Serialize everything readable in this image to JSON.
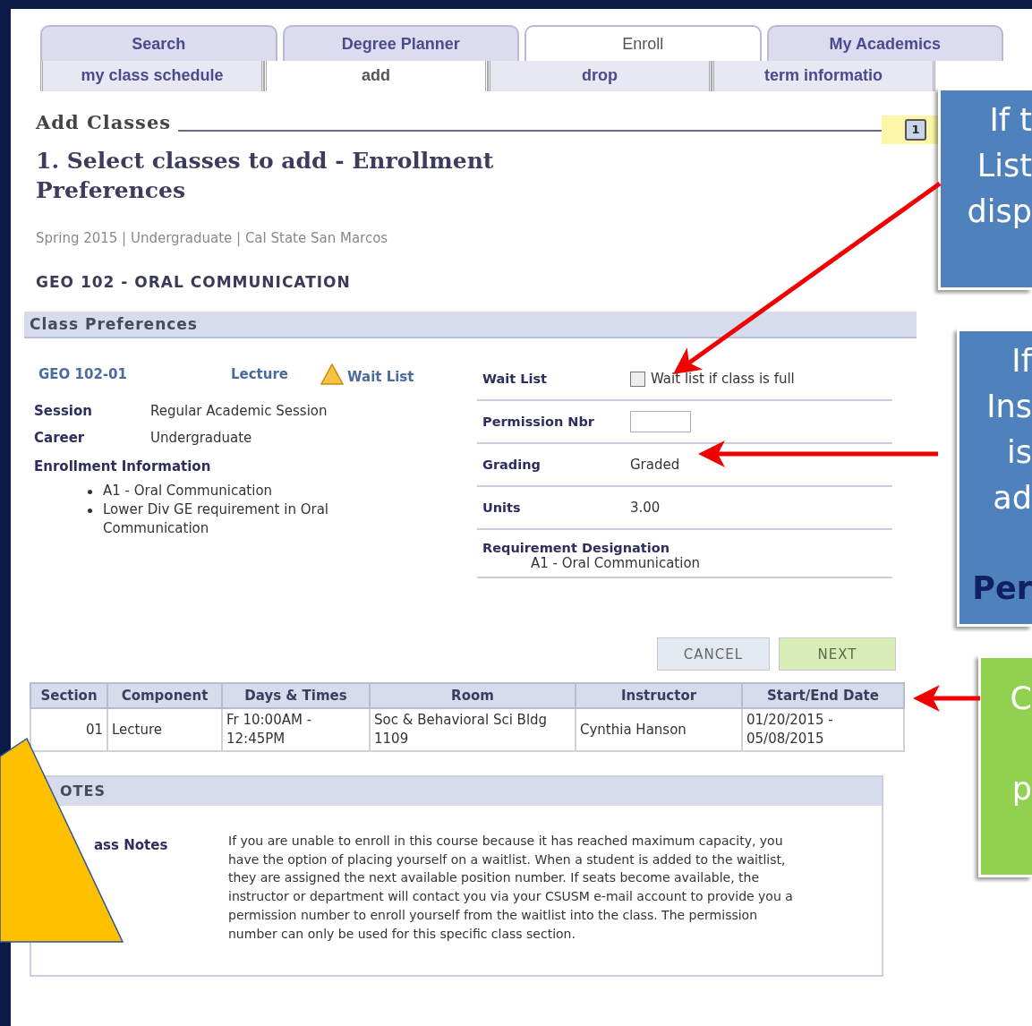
{
  "tabs": [
    {
      "label": "Search",
      "selected": false
    },
    {
      "label": "Degree Planner",
      "selected": false
    },
    {
      "label": "Enroll",
      "selected": true
    },
    {
      "label": "My Academics",
      "selected": false
    }
  ],
  "subtabs": [
    {
      "label": "my class schedule",
      "selected": false
    },
    {
      "label": "add",
      "selected": true
    },
    {
      "label": "drop",
      "selected": false
    },
    {
      "label": "term informatio",
      "selected": false
    }
  ],
  "page_title": "Add Classes",
  "step": {
    "label": "1",
    "selected": true
  },
  "heading": "1.  Select classes to add - Enrollment Preferences",
  "term_line": "Spring 2015 | Undergraduate | Cal State San Marcos",
  "course_title": "GEO  102 - ORAL COMMUNICATION",
  "class_preferences": {
    "header": "Class Preferences",
    "section": "GEO  102-01",
    "component": "Lecture",
    "status": "Wait List",
    "details": [
      {
        "label": "Session",
        "value": "Regular Academic Session"
      },
      {
        "label": "Career",
        "value": "Undergraduate"
      }
    ],
    "enrollment_info_label": "Enrollment Information",
    "enrollment_info": [
      "A1 - Oral Communication",
      "Lower Div GE requirement in Oral Communication"
    ],
    "fields": [
      {
        "kind": "checkbox",
        "label": "Wait List",
        "text": "Wait list if class is full",
        "checked": false
      },
      {
        "kind": "input",
        "label": "Permission Nbr"
      },
      {
        "kind": "text",
        "label": "Grading",
        "value": "Graded"
      },
      {
        "kind": "text",
        "label": "Units",
        "value": "3.00"
      },
      {
        "kind": "block",
        "label": "Requirement Designation",
        "value": "A1 - Oral Communication"
      }
    ]
  },
  "buttons": [
    {
      "label": "CANCEL",
      "kind": "secondary"
    },
    {
      "label": "NEXT",
      "kind": "primary"
    }
  ],
  "table": {
    "columns": [
      "Section",
      "Component",
      "Days & Times",
      "Room",
      "Instructor",
      "Start/End Date"
    ],
    "rows": [
      [
        "01",
        "Lecture",
        "Fr 10:00AM - 12:45PM",
        "Soc & Behavioral Sci Bldg 1109",
        "Cynthia Hanson",
        "01/20/2015 - 05/08/2015"
      ]
    ]
  },
  "notes": {
    "header": "OTES",
    "label": "ass Notes",
    "text": "If you are unable to enroll in this course because it has reached maximum capacity, you have the option of placing yourself on a waitlist. When a student is added to the waitlist, they are assigned the next available position number. If seats become available, the instructor or department will contact you via your CSUSM e-mail account to provide you a permission number to enroll yourself from the waitlist into the class. The permission number can only be used for this specific class section."
  },
  "callouts": [
    {
      "kind": "blue",
      "lines": [
        {
          "text": "If t",
          "bold": false
        },
        {
          "text": "List",
          "bold": false
        },
        {
          "text": "disp",
          "bold": false
        }
      ]
    },
    {
      "kind": "blue",
      "lines": [
        {
          "text": "If",
          "bold": false
        },
        {
          "text": "Ins",
          "bold": false
        },
        {
          "text": "is",
          "bold": false
        },
        {
          "text": "ad",
          "bold": false
        },
        {
          "text": "Per",
          "bold": true
        }
      ]
    },
    {
      "kind": "green",
      "lines": [
        {
          "text": "C",
          "bold": false
        },
        {
          "text": "p",
          "bold": false
        }
      ]
    }
  ]
}
